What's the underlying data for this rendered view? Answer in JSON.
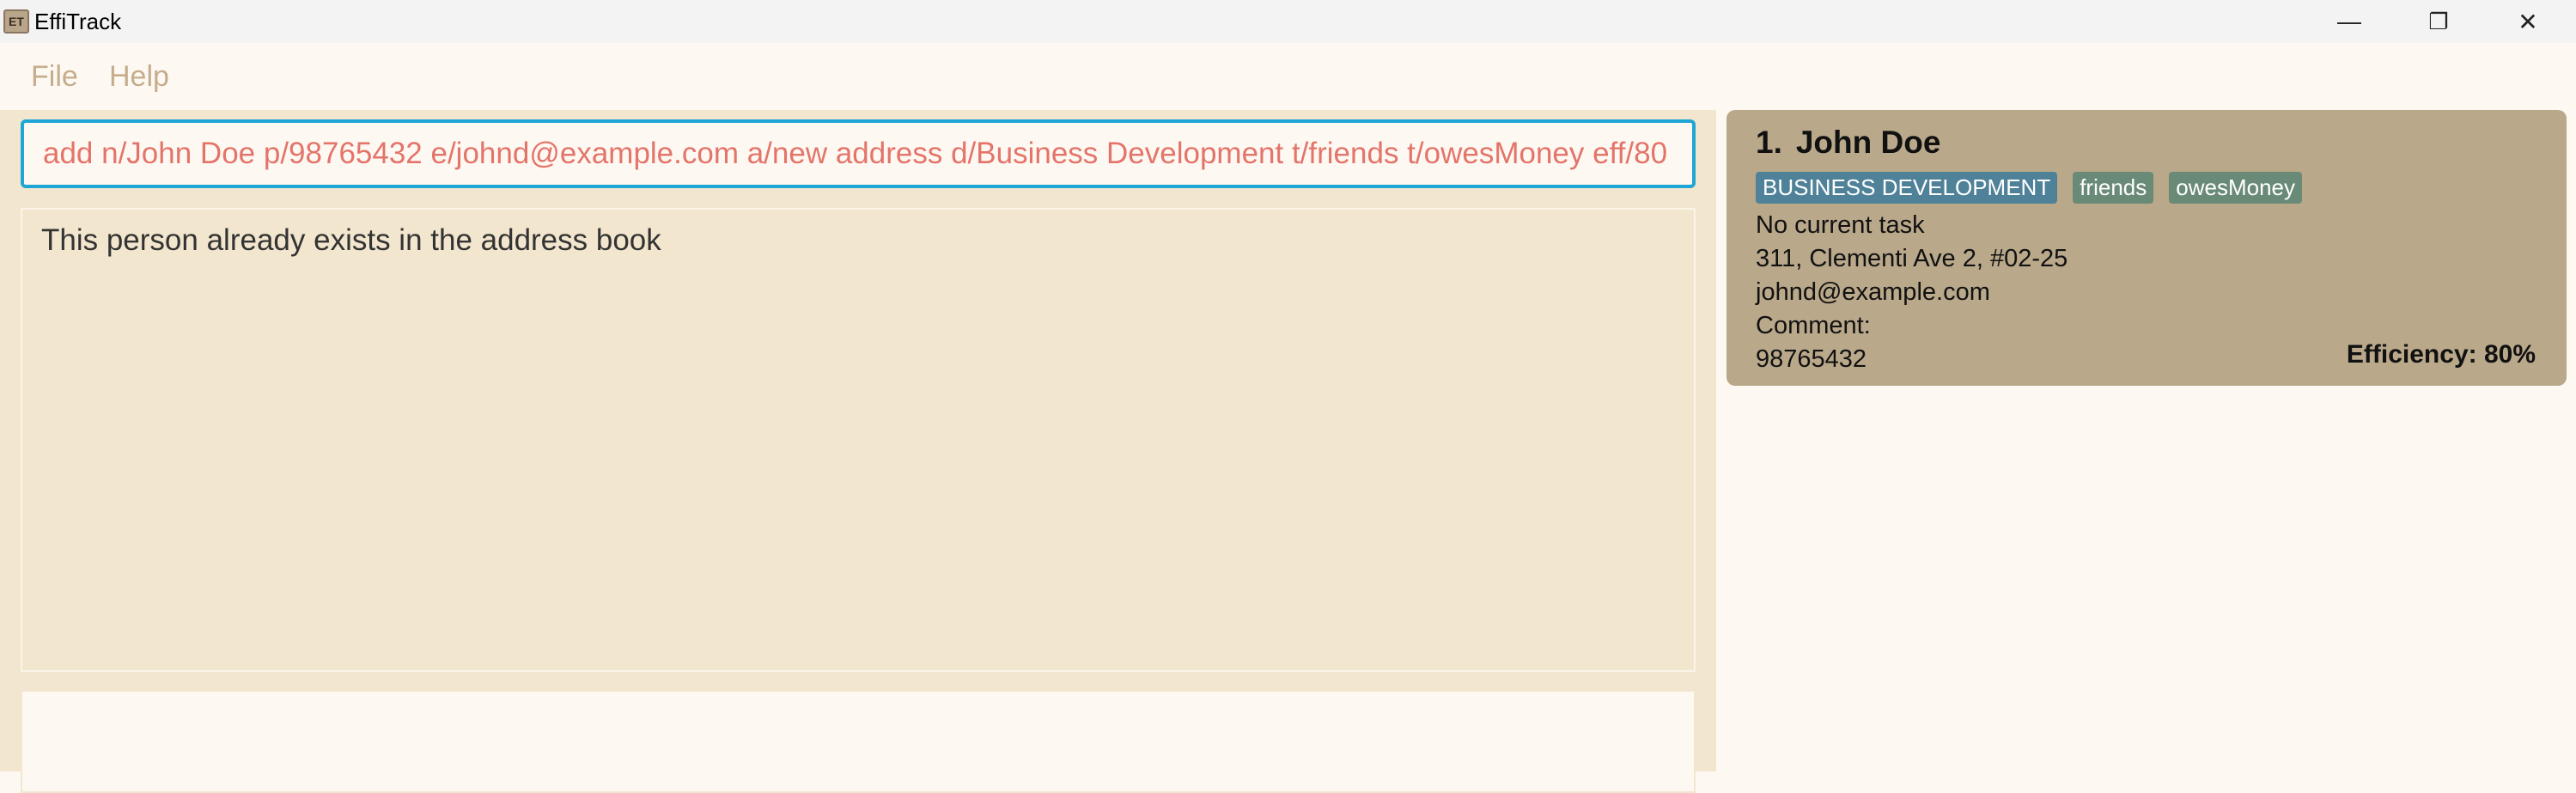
{
  "window": {
    "title": "EffiTrack",
    "icon_text": "ET",
    "controls": {
      "minimize": "—",
      "restore": "❐",
      "close": "✕"
    }
  },
  "menu": {
    "items": [
      {
        "label": "File"
      },
      {
        "label": "Help"
      }
    ]
  },
  "command": {
    "value": "add n/John Doe p/98765432 e/johnd@example.com a/new address d/Business Development t/friends t/owesMoney eff/80"
  },
  "result": {
    "message": "This person already exists in the address book"
  },
  "persons": [
    {
      "index": "1.",
      "name": "John Doe",
      "department": "BUSINESS DEVELOPMENT",
      "tags": [
        "friends",
        "owesMoney"
      ],
      "task": "No current task",
      "address": "311, Clementi Ave 2, #02-25",
      "email": "johnd@example.com",
      "comment": "Comment:",
      "phone": "98765432",
      "efficiency": "Efficiency: 80%"
    }
  ],
  "colors": {
    "command_text": "#e4746a",
    "command_border": "#1ea6d6",
    "card_background": "#b9a88a",
    "department_tag": "#4f8298",
    "tag": "#6a8a78"
  }
}
